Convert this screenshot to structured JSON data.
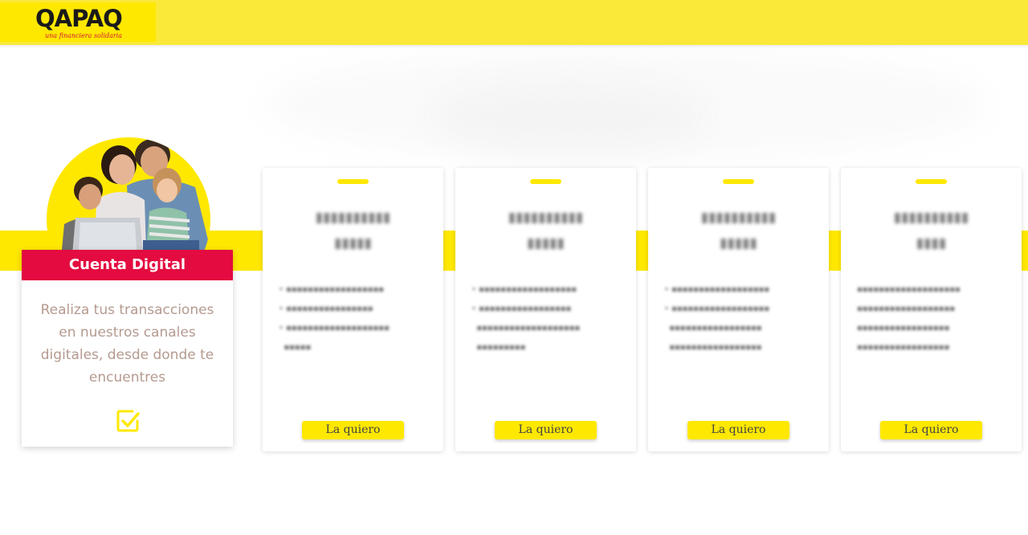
{
  "header": {
    "logo_text": "QAPAQ",
    "logo_tagline": "una financiera solidaria",
    "brand_yellow": "#ffe800",
    "brand_red": "#e30b40"
  },
  "featured": {
    "title": "Cuenta Digital",
    "description": "Realiza tus transacciones en nuestros canales digitales, desde donde te encuentres",
    "icon": "checkbox-check-icon",
    "image": "family-laptop-photo"
  },
  "products": [
    {
      "button_label": "La quiero"
    },
    {
      "button_label": "La quiero"
    },
    {
      "button_label": "La quiero"
    },
    {
      "button_label": "La quiero"
    }
  ]
}
